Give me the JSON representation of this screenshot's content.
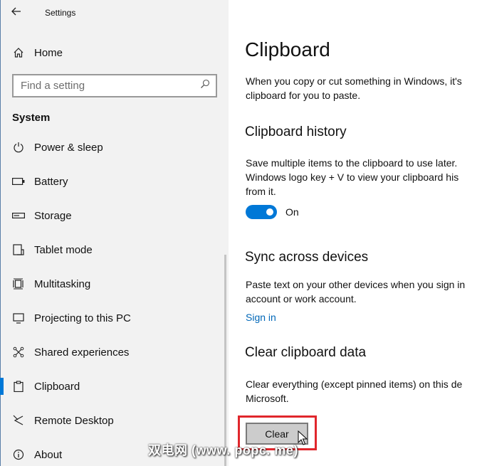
{
  "window": {
    "title": "Settings"
  },
  "sidebar": {
    "home_label": "Home",
    "search_placeholder": "Find a setting",
    "section_title": "System",
    "items": [
      {
        "label": "Power & sleep",
        "icon": "power-icon"
      },
      {
        "label": "Battery",
        "icon": "battery-icon"
      },
      {
        "label": "Storage",
        "icon": "storage-icon"
      },
      {
        "label": "Tablet mode",
        "icon": "tablet-mode-icon"
      },
      {
        "label": "Multitasking",
        "icon": "multitasking-icon"
      },
      {
        "label": "Projecting to this PC",
        "icon": "projecting-icon"
      },
      {
        "label": "Shared experiences",
        "icon": "shared-experiences-icon"
      },
      {
        "label": "Clipboard",
        "icon": "clipboard-icon",
        "selected": true
      },
      {
        "label": "Remote Desktop",
        "icon": "remote-desktop-icon"
      },
      {
        "label": "About",
        "icon": "about-icon"
      }
    ]
  },
  "main": {
    "title": "Clipboard",
    "intro_line1": "When you copy or cut something in Windows, it's",
    "intro_line2": "clipboard for you to paste.",
    "history": {
      "heading": "Clipboard history",
      "line1": "Save multiple items to the clipboard to use later.",
      "line2": "Windows logo key + V to view your clipboard his",
      "line3": "from it.",
      "toggle_state": "On"
    },
    "sync": {
      "heading": "Sync across devices",
      "line1": "Paste text on your other devices when you sign in",
      "line2": "account or work account.",
      "link": "Sign in"
    },
    "clear": {
      "heading": "Clear clipboard data",
      "line1": "Clear everything (except pinned items) on this de",
      "line2": "Microsoft.",
      "button_label": "Clear"
    }
  },
  "watermark": "双电网 (www. popc. me)",
  "colors": {
    "accent": "#0078d7",
    "link": "#0067b8",
    "highlight": "#e0262c",
    "sidebar_bg": "#f2f2f2"
  }
}
